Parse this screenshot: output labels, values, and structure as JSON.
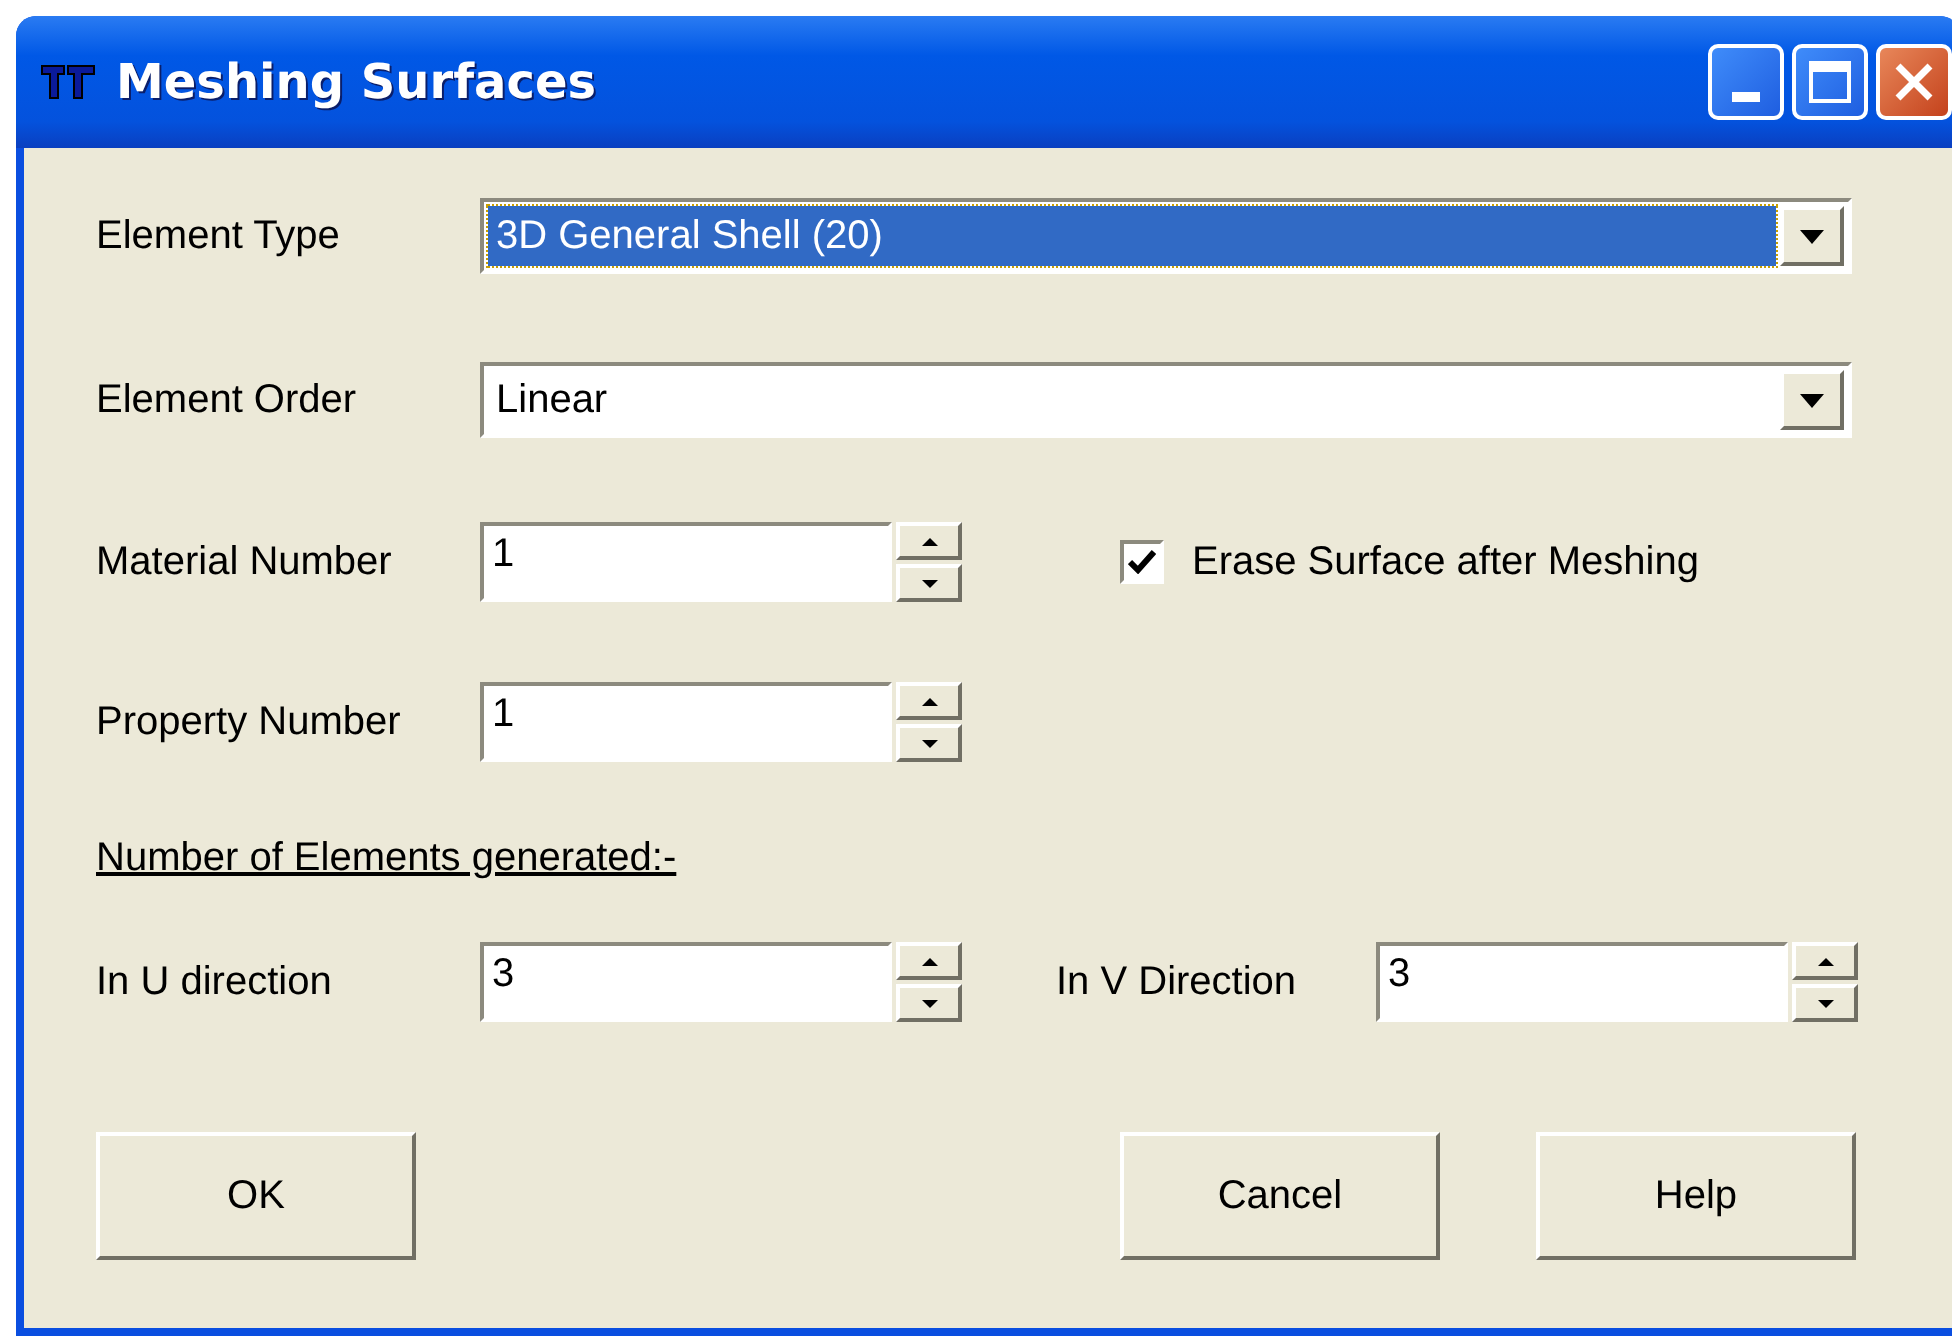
{
  "window": {
    "title": "Meshing Surfaces"
  },
  "element_type": {
    "label": "Element Type",
    "value": "3D General Shell (20)",
    "highlighted": true
  },
  "element_order": {
    "label": "Element Order",
    "value": "Linear",
    "highlighted": false
  },
  "material_number": {
    "label": "Material Number",
    "value": "1"
  },
  "erase_surface": {
    "label": "Erase Surface after Meshing",
    "checked": true
  },
  "property_number": {
    "label": "Property Number",
    "value": "1"
  },
  "section_heading": "Number of Elements generated:-",
  "u_direction": {
    "label": "In U direction",
    "value": "3"
  },
  "v_direction": {
    "label": "In V Direction",
    "value": "3"
  },
  "buttons": [
    {
      "label": "OK"
    },
    {
      "label": "Cancel"
    },
    {
      "label": "Help"
    }
  ]
}
